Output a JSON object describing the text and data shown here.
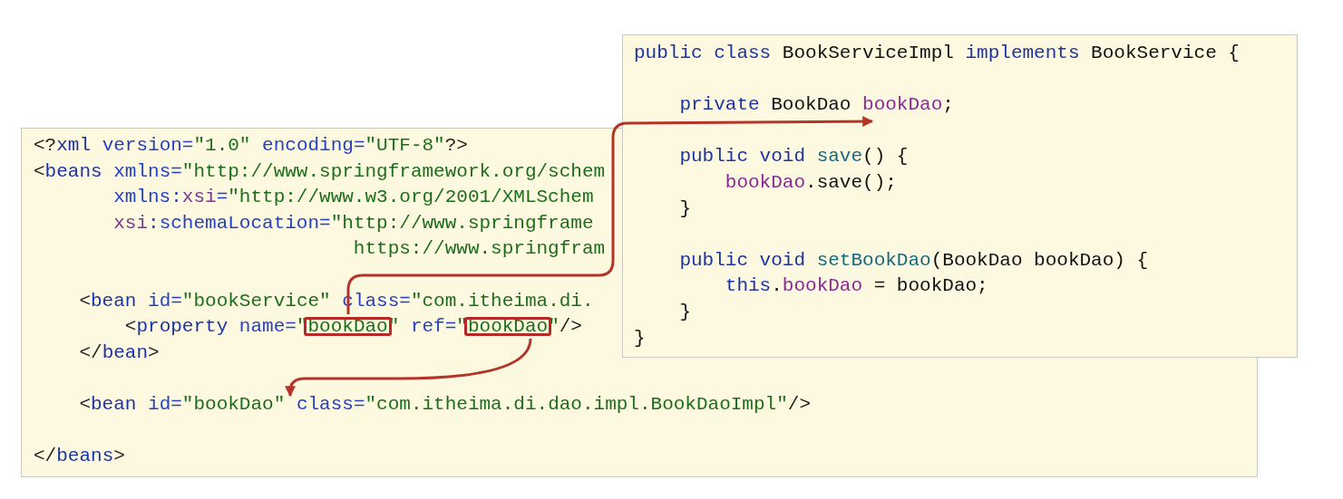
{
  "xml_panel": {
    "lines": [
      {
        "kind": "code",
        "tokens": [
          {
            "text": "<?",
            "kind": "punct"
          },
          {
            "text": "xml",
            "kind": "tag"
          },
          {
            "text": " version=",
            "kind": "attr"
          },
          {
            "text": "\"1.0\"",
            "kind": "value"
          },
          {
            "text": " encoding=",
            "kind": "attr"
          },
          {
            "text": "\"UTF-8\"",
            "kind": "value"
          },
          {
            "text": "?>",
            "kind": "punct"
          }
        ]
      },
      {
        "kind": "code",
        "tokens": [
          {
            "text": "<",
            "kind": "punct"
          },
          {
            "text": "beans",
            "kind": "tag"
          },
          {
            "text": " xmlns=",
            "kind": "attr"
          },
          {
            "text": "\"http://www.springframework.org/schem",
            "kind": "value"
          }
        ]
      },
      {
        "kind": "code",
        "tokens": [
          {
            "text": "       xmlns:",
            "kind": "attr"
          },
          {
            "text": "xsi",
            "kind": "ns"
          },
          {
            "text": "=",
            "kind": "attr"
          },
          {
            "text": "\"http://www.w3.org/2001/XMLSchem",
            "kind": "value"
          }
        ]
      },
      {
        "kind": "code",
        "tokens": [
          {
            "text": "       xsi",
            "kind": "ns"
          },
          {
            "text": ":schemaLocation=",
            "kind": "attr"
          },
          {
            "text": "\"http://www.springframe",
            "kind": "value"
          }
        ]
      },
      {
        "kind": "code",
        "tokens": [
          {
            "text": "                            https://www.springfram",
            "kind": "value"
          }
        ]
      },
      {
        "kind": "blank"
      },
      {
        "kind": "code",
        "tokens": [
          {
            "text": "    <",
            "kind": "punct"
          },
          {
            "text": "bean",
            "kind": "tag"
          },
          {
            "text": " id=",
            "kind": "attr"
          },
          {
            "text": "\"bookService\"",
            "kind": "value"
          },
          {
            "text": " class=",
            "kind": "attr"
          },
          {
            "text": "\"com.itheima.di.",
            "kind": "value"
          }
        ]
      },
      {
        "kind": "code",
        "tokens": [
          {
            "text": "        <",
            "kind": "punct"
          },
          {
            "text": "property",
            "kind": "tag"
          },
          {
            "text": " name=",
            "kind": "attr"
          },
          {
            "text": "\"",
            "kind": "value"
          },
          {
            "text": "bookDao",
            "kind": "boxed"
          },
          {
            "text": "\"",
            "kind": "value"
          },
          {
            "text": " ref=",
            "kind": "attr"
          },
          {
            "text": "\"",
            "kind": "value"
          },
          {
            "text": "bookDao",
            "kind": "boxed"
          },
          {
            "text": "\"",
            "kind": "value"
          },
          {
            "text": "/>",
            "kind": "punct"
          }
        ]
      },
      {
        "kind": "code",
        "tokens": [
          {
            "text": "    </",
            "kind": "punct"
          },
          {
            "text": "bean",
            "kind": "tag"
          },
          {
            "text": ">",
            "kind": "punct"
          }
        ]
      },
      {
        "kind": "blank"
      },
      {
        "kind": "code",
        "tokens": [
          {
            "text": "    <",
            "kind": "punct"
          },
          {
            "text": "bean",
            "kind": "tag"
          },
          {
            "text": " id=",
            "kind": "attr"
          },
          {
            "text": "\"bookDao\"",
            "kind": "value"
          },
          {
            "text": " class=",
            "kind": "attr"
          },
          {
            "text": "\"com.itheima.di.dao.impl.BookDaoImpl\"",
            "kind": "value"
          },
          {
            "text": "/>",
            "kind": "punct"
          }
        ]
      },
      {
        "kind": "blank"
      },
      {
        "kind": "code",
        "tokens": [
          {
            "text": "</",
            "kind": "punct"
          },
          {
            "text": "beans",
            "kind": "tag"
          },
          {
            "text": ">",
            "kind": "punct"
          }
        ]
      }
    ]
  },
  "java_panel": {
    "lines": [
      {
        "kind": "code",
        "tokens": [
          {
            "text": "public class",
            "kind": "keyword"
          },
          {
            "text": " BookServiceImpl ",
            "kind": "plain"
          },
          {
            "text": "implements",
            "kind": "keyword"
          },
          {
            "text": " BookService {",
            "kind": "plain"
          }
        ]
      },
      {
        "kind": "blank"
      },
      {
        "kind": "code",
        "tokens": [
          {
            "text": "    private",
            "kind": "keyword"
          },
          {
            "text": " BookDao ",
            "kind": "plain"
          },
          {
            "text": "bookDao",
            "kind": "field"
          },
          {
            "text": ";",
            "kind": "plain"
          }
        ]
      },
      {
        "kind": "blank"
      },
      {
        "kind": "code",
        "tokens": [
          {
            "text": "    public void ",
            "kind": "keyword"
          },
          {
            "text": "save",
            "kind": "method"
          },
          {
            "text": "() {",
            "kind": "plain"
          }
        ]
      },
      {
        "kind": "code",
        "tokens": [
          {
            "text": "        bookDao",
            "kind": "field"
          },
          {
            "text": ".save();",
            "kind": "plain"
          }
        ]
      },
      {
        "kind": "code",
        "tokens": [
          {
            "text": "    }",
            "kind": "plain"
          }
        ]
      },
      {
        "kind": "blank"
      },
      {
        "kind": "code",
        "tokens": [
          {
            "text": "    public void ",
            "kind": "keyword"
          },
          {
            "text": "setBookDao",
            "kind": "method"
          },
          {
            "text": "(BookDao bookDao) {",
            "kind": "plain"
          }
        ]
      },
      {
        "kind": "code",
        "tokens": [
          {
            "text": "        this",
            "kind": "keyword"
          },
          {
            "text": ".",
            "kind": "plain"
          },
          {
            "text": "bookDao",
            "kind": "field"
          },
          {
            "text": " = bookDao;",
            "kind": "plain"
          }
        ]
      },
      {
        "kind": "code",
        "tokens": [
          {
            "text": "    }",
            "kind": "plain"
          }
        ]
      },
      {
        "kind": "code",
        "tokens": [
          {
            "text": "}",
            "kind": "plain"
          }
        ]
      }
    ]
  }
}
